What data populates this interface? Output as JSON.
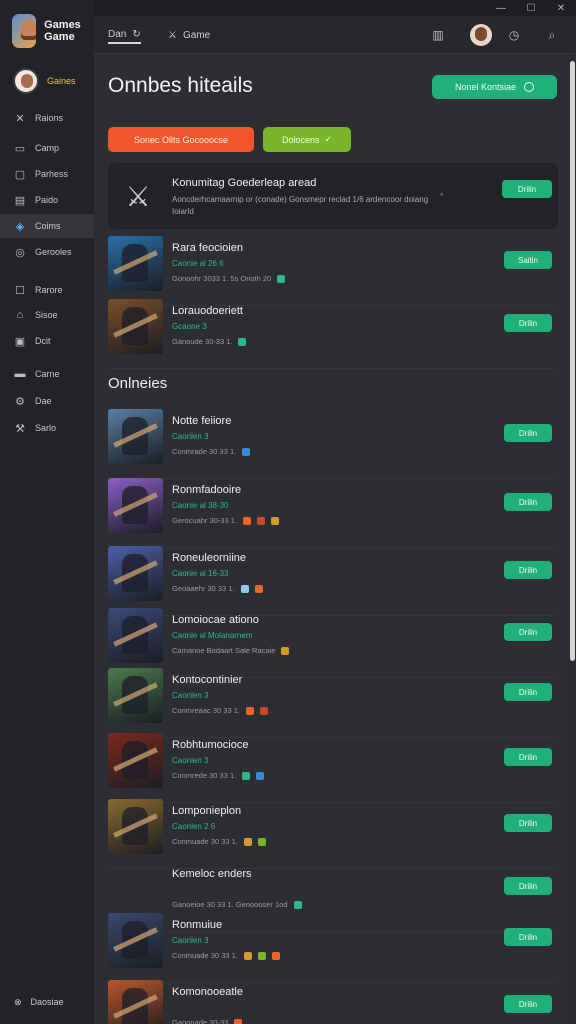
{
  "window": {
    "minimize_glyph": "—",
    "maximize_glyph": "☐",
    "close_glyph": "✕"
  },
  "sidebar": {
    "logo_text": "Games Game",
    "profile_name": "Gaines",
    "items": [
      {
        "label": "Raions",
        "icon": "✕",
        "icon_name": "shuffle-icon"
      },
      {
        "label": "Camp",
        "icon": "▭",
        "icon_name": "window-icon"
      },
      {
        "label": "Parhess",
        "icon": "▢",
        "icon_name": "book-icon"
      },
      {
        "label": "Paido",
        "icon": "▤",
        "icon_name": "list-icon"
      },
      {
        "label": "Coims",
        "icon": "◈",
        "icon_name": "games-icon"
      },
      {
        "label": "Gerooles",
        "icon": "◎",
        "icon_name": "globe-icon"
      },
      {
        "label": "Rarore",
        "icon": "☐",
        "icon_name": "square-icon"
      },
      {
        "label": "Sisoe",
        "icon": "⌂",
        "icon_name": "home-icon"
      },
      {
        "label": "Dcit",
        "icon": "▣",
        "icon_name": "grid-icon"
      },
      {
        "label": "Carne",
        "icon": "▬",
        "icon_name": "controller-icon"
      },
      {
        "label": "Dae",
        "icon": "⚙",
        "icon_name": "settings-icon"
      },
      {
        "label": "Sarlo",
        "icon": "⚒",
        "icon_name": "tools-icon"
      }
    ],
    "footer_label": "Daosiae",
    "footer_icon": "⊗"
  },
  "topbar": {
    "tabs": [
      {
        "label": "Dan",
        "icon": "↻"
      },
      {
        "label": "Game",
        "icon": "⚔"
      }
    ],
    "icons": {
      "library": "▥",
      "clock": "◷",
      "search": "⌕"
    }
  },
  "page": {
    "title": "Onnbes hiteails",
    "primary_button": "Nonel Kontsiae",
    "chip_orange": "Sonec Olits Gocooocse",
    "chip_green": "Dolocens",
    "chip_green_icon": "✓"
  },
  "featured": {
    "title": "Konumitag Goederleap aread",
    "description": "Aoncderhcamaarnip or (conade) Gonsmepr reclad 1/6 ardencoor doiang Ioiarld",
    "action": "Drilin",
    "icon": "⚔",
    "extra_icon": "◦"
  },
  "list_top": [
    {
      "name": "Rara feocioien",
      "sub": "Caonie al 26 6",
      "meta": "Gonoohr 3033 1. 5s Orioth 20",
      "action": "Saitin",
      "thumb": "#2a6fa8",
      "tags": [
        "#2fb985"
      ]
    },
    {
      "name": "Lorauodoeriett",
      "sub": "Gcaone 3",
      "meta": "Ganoude 30-33 1.",
      "action": "Drilin",
      "thumb": "#7a4e2b",
      "tags": [
        "#2fb985"
      ]
    }
  ],
  "section_title": "Onlneies",
  "list": [
    {
      "name": "Notte feiiore",
      "sub": "Caonlen 3",
      "meta": "Conmrade 30 33 1.",
      "action": "Drilin",
      "thumb": "#5a7fa3",
      "tags": [
        "#3a88d8"
      ]
    },
    {
      "name": "Ronmfadooire",
      "sub": "Caonie al 38-30",
      "meta": "Gerocuahr 30-33 1.",
      "action": "Drilin",
      "thumb": "#8b5fc9",
      "tags": [
        "#e8662a",
        "#c84a2a",
        "#d59a2a"
      ]
    },
    {
      "name": "Roneuleorniine",
      "sub": "Caonie al 16-33",
      "meta": "Geoaaehr 30 33 1.",
      "action": "Drilin",
      "thumb": "#4a5fa8",
      "tags": [
        "#8fc9e8",
        "#e8662a"
      ]
    },
    {
      "name": "Lomoiocae ationo",
      "sub": "Caonie al Molanarnem",
      "meta": "Camanoe Bodaart Sale Racaie",
      "action": "Drilin",
      "thumb": "#3a4a7a",
      "tags": [
        "#d59a2a"
      ]
    },
    {
      "name": "Kontocontinier",
      "sub": "Caonlen 3",
      "meta": "Conmreaac 30 33 1.",
      "action": "Drilin",
      "thumb": "#4a7a4e",
      "tags": [
        "#e8662a",
        "#c84a2a"
      ]
    },
    {
      "name": "Robhtumocioce",
      "sub": "Caonlen 3",
      "meta": "Conmrede 30 33 1.",
      "action": "Drilin",
      "thumb": "#7a2a1e",
      "tags": [
        "#2fb985",
        "#3a88d8"
      ]
    },
    {
      "name": "Lomponieplon",
      "sub": "Caonlen 2 6",
      "meta": "Conmuade 30 33 1.",
      "action": "Drilin",
      "thumb": "#8a6a2e",
      "tags": [
        "#d59a2a",
        "#7ab62c"
      ]
    },
    {
      "name": "Kemeloc enders",
      "sub": "",
      "meta": "Ganoeioe 30 33 1. Genoooser 1od",
      "action": "Drilin",
      "thumb": "#2d2e33",
      "tags": [
        "#2fb985"
      ]
    },
    {
      "name": "Ronmuiue",
      "sub": "Caonlen 3",
      "meta": "Conmuade 30 33 1.",
      "action": "Drilin",
      "thumb": "#3a4a6e",
      "tags": [
        "#d59a2a",
        "#7ab62c",
        "#e8662a"
      ]
    },
    {
      "name": "Komonooeatle",
      "sub": "",
      "meta": "Ganonade 30-33",
      "action": "Drilin",
      "thumb": "#b8562a",
      "tags": [
        "#e8662a"
      ]
    }
  ]
}
